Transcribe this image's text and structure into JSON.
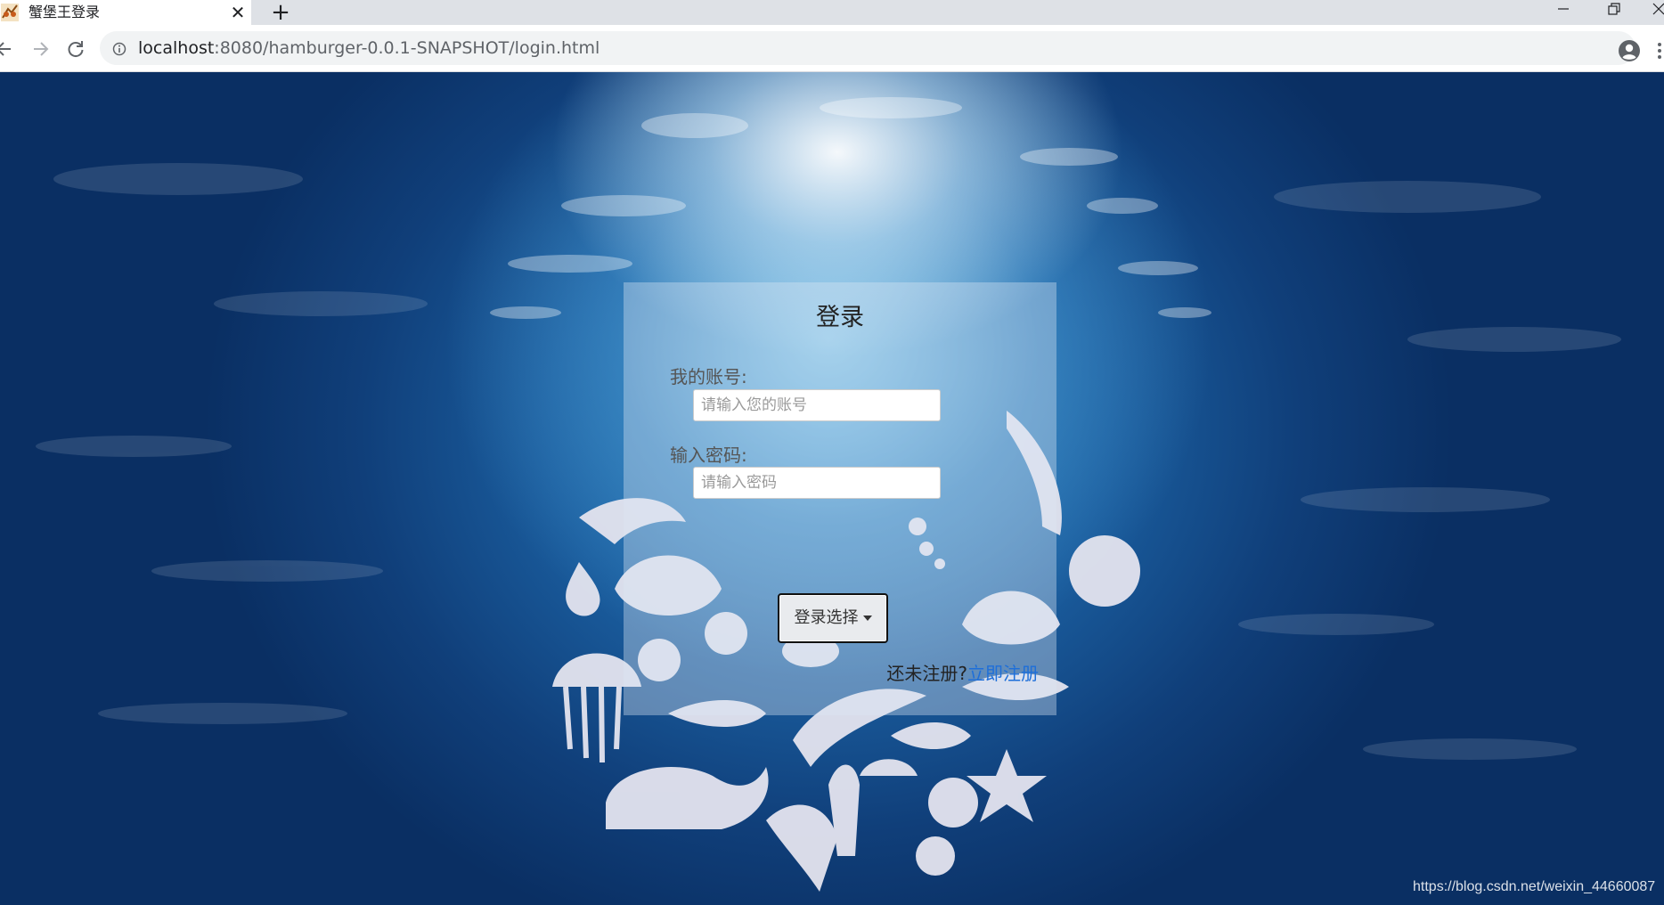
{
  "browser": {
    "tab": {
      "title": "蟹堡王登录",
      "close_symbol": "✕",
      "favicon": "crab-favicon-icon"
    },
    "new_tab_symbol": "+",
    "url": {
      "host": "localhost",
      "rest": ":8080/hamburger-0.0.1-SNAPSHOT/login.html"
    },
    "window_controls": {
      "minimize": "—",
      "restore": "❐",
      "close": "✕"
    },
    "icons": {
      "back": "arrow-left-icon",
      "forward": "arrow-right-icon",
      "reload": "reload-icon",
      "info": "info-circle-icon",
      "bookmark": "star-icon",
      "profile": "account-circle-icon",
      "menu": "more-vert-icon"
    }
  },
  "login": {
    "title": "登录",
    "account_label": "我的账号:",
    "account_placeholder": "请输入您的账号",
    "password_label": "输入密码:",
    "password_placeholder": "请输入密码",
    "select_button_label": "登录选择",
    "register_prompt": "还未注册?",
    "register_link": "立即注册"
  },
  "watermark": "https://blog.csdn.net/weixin_44660087",
  "colors": {
    "link": "#1e6fd9",
    "tab_strip": "#dee1e6",
    "omnibox": "#f1f3f4",
    "ocean_deep": "#0a2f63",
    "ocean_light": "#2c86c4"
  }
}
